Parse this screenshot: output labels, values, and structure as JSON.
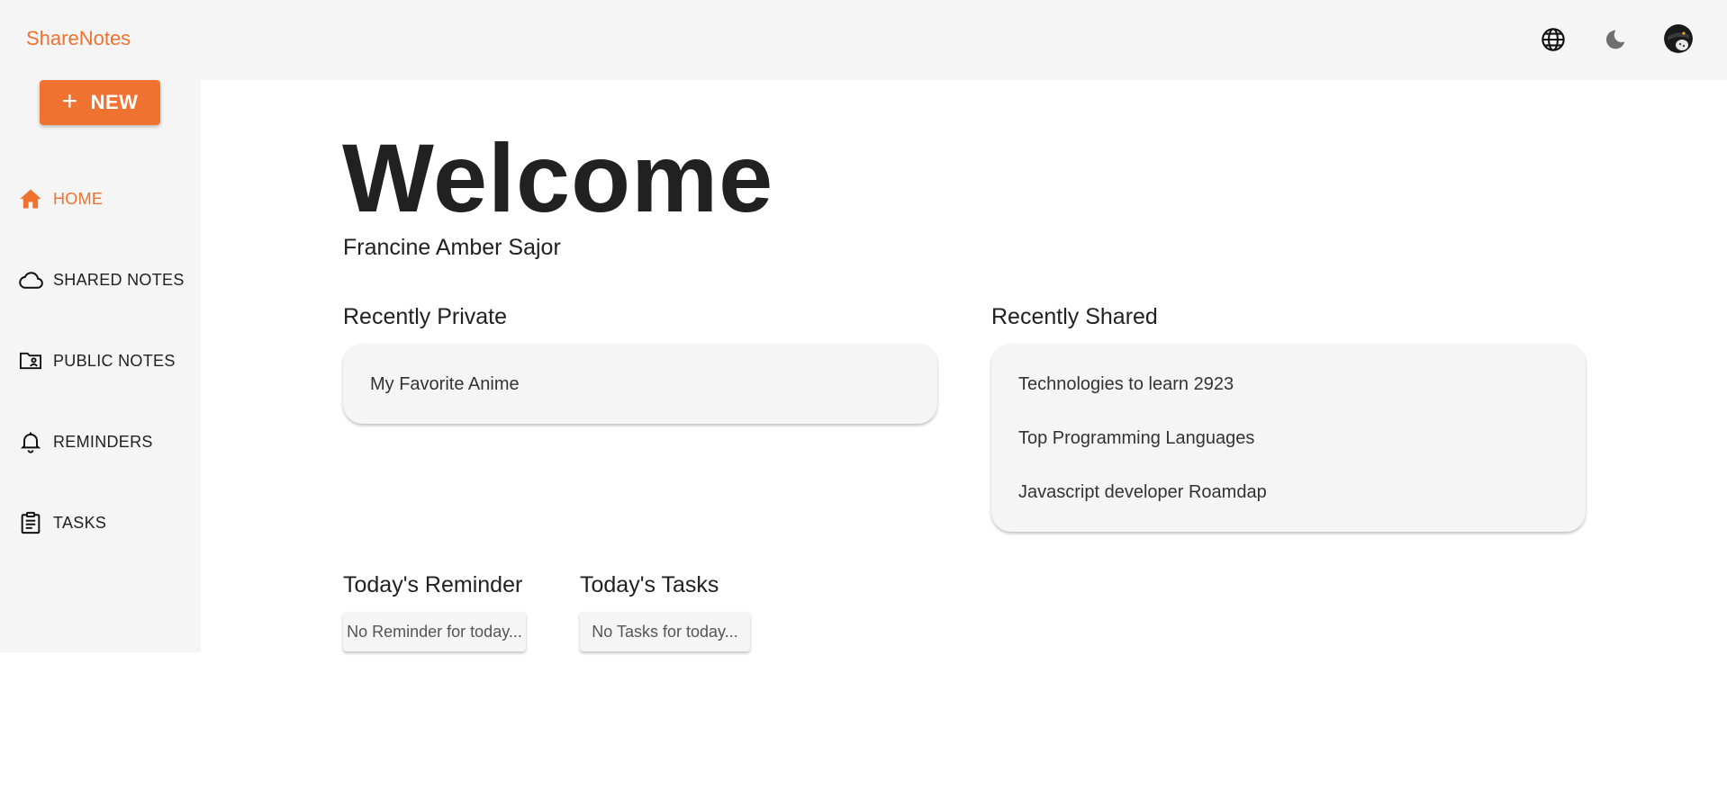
{
  "app": {
    "brand": "ShareNotes"
  },
  "header": {
    "language_icon": "globe-icon",
    "theme_icon": "moon-icon",
    "avatar_icon": "user-avatar"
  },
  "sidebar": {
    "new_label": "NEW",
    "items": [
      {
        "label": "HOME",
        "icon": "home-icon",
        "active": true
      },
      {
        "label": "SHARED NOTES",
        "icon": "cloud-icon",
        "active": false
      },
      {
        "label": "PUBLIC NOTES",
        "icon": "folder-user-icon",
        "active": false
      },
      {
        "label": "REMINDERS",
        "icon": "bell-icon",
        "active": false
      },
      {
        "label": "TASKS",
        "icon": "clipboard-icon",
        "active": false
      }
    ]
  },
  "main": {
    "welcome": "Welcome",
    "username": "Francine Amber Sajor",
    "recent_private": {
      "title": "Recently Private",
      "items": [
        "My Favorite Anime"
      ]
    },
    "recent_shared": {
      "title": "Recently Shared",
      "items": [
        "Technologies to learn 2923",
        "Top Programming Languages",
        "Javascript developer Roamdap"
      ]
    },
    "reminder": {
      "title": "Today's Reminder",
      "empty": "No Reminder for today..."
    },
    "tasks": {
      "title": "Today's Tasks",
      "empty": "No Tasks for today..."
    }
  },
  "colors": {
    "accent": "#f07230",
    "panel": "#f5f5f5",
    "text": "#212121"
  }
}
